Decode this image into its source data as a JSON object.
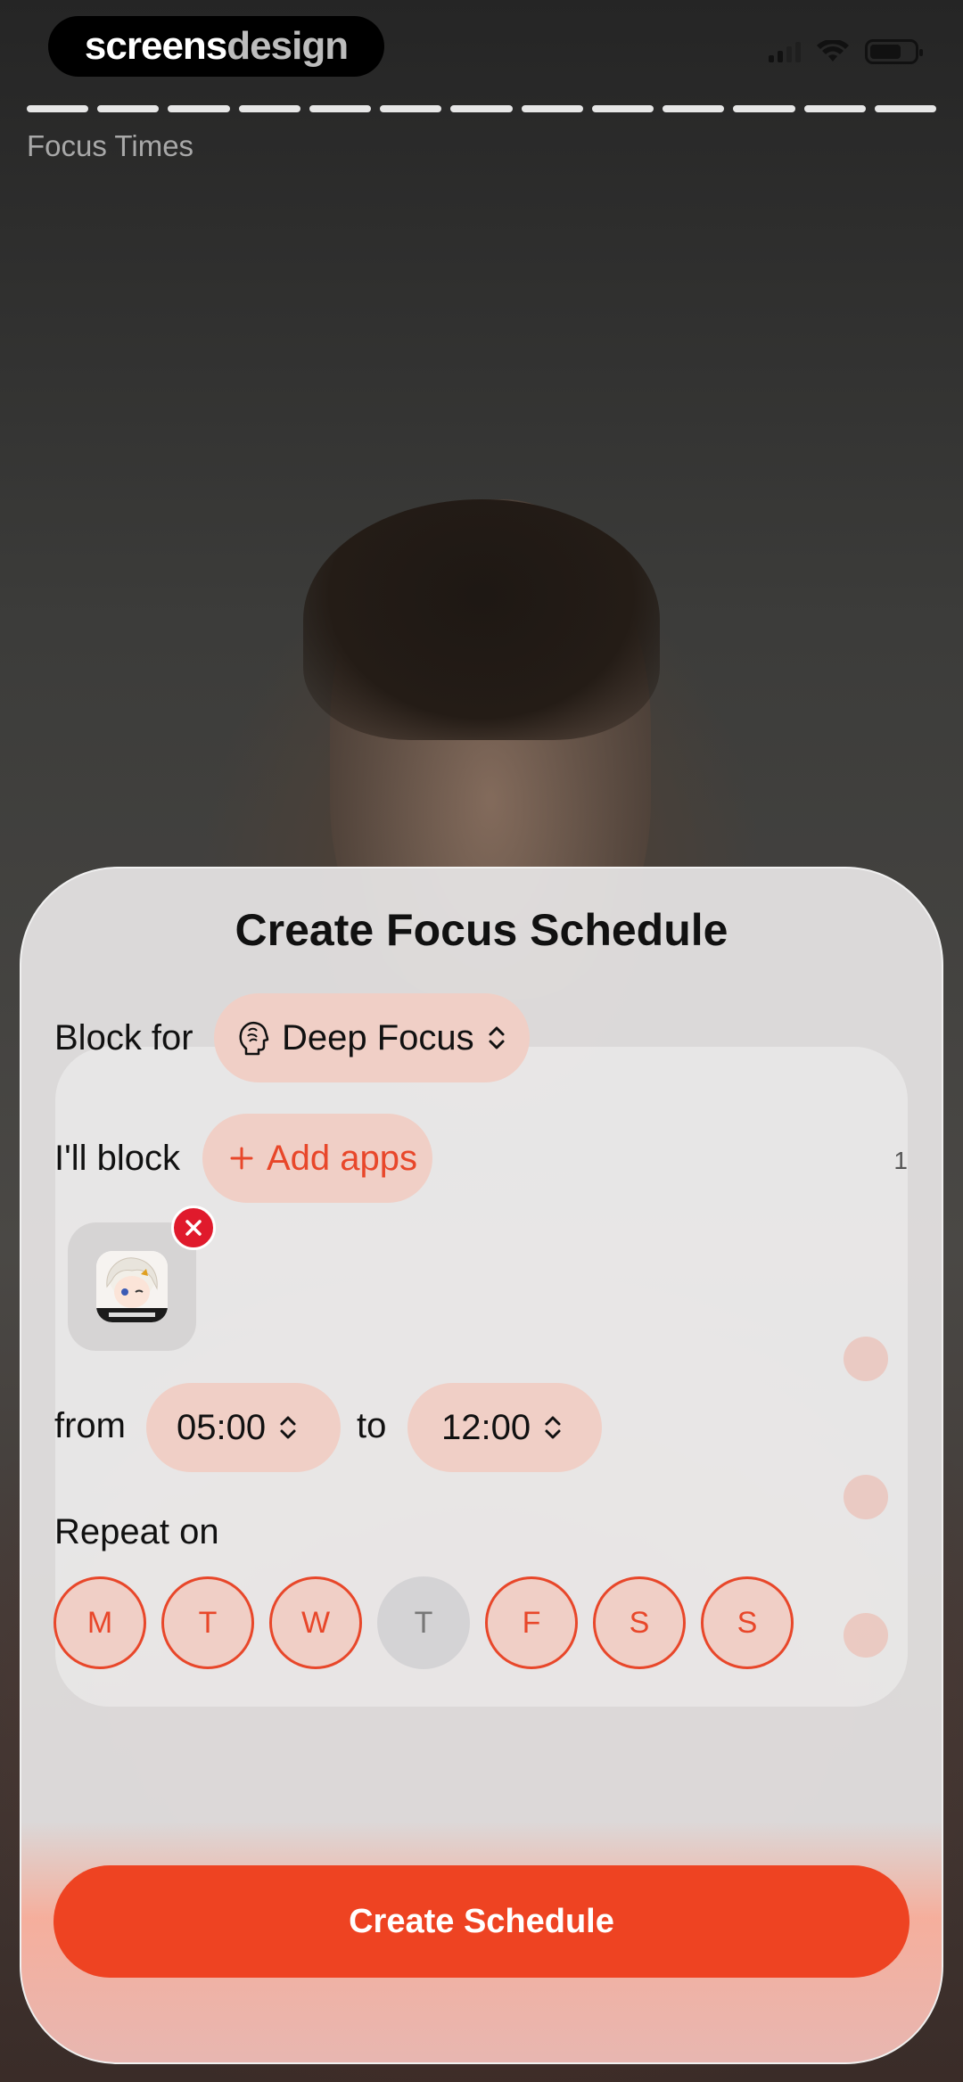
{
  "brand": {
    "part1": "screens",
    "part2": "design"
  },
  "screen_title": "Focus Times",
  "progress_segments": 13,
  "sheet": {
    "title": "Create Focus Schedule",
    "block_for_label": "Block for",
    "mode_value": "Deep Focus",
    "block_label": "I'll block",
    "add_apps_label": "Add apps",
    "blocked_apps": [
      {
        "name": "HoYoverse app",
        "icon": "app-icon"
      }
    ],
    "from_label": "from",
    "from_time": "05:00",
    "to_label": "to",
    "to_time": "12:00",
    "repeat_label": "Repeat on",
    "days": [
      {
        "letter": "M",
        "selected": true
      },
      {
        "letter": "T",
        "selected": true
      },
      {
        "letter": "W",
        "selected": true
      },
      {
        "letter": "T",
        "selected": false
      },
      {
        "letter": "F",
        "selected": true
      },
      {
        "letter": "S",
        "selected": true
      },
      {
        "letter": "S",
        "selected": true
      }
    ],
    "background_count": "1",
    "create_button": "Create Schedule"
  },
  "colors": {
    "accent": "#EE4322",
    "pill": "#F0CFC6",
    "remove": "#E01A2C"
  }
}
